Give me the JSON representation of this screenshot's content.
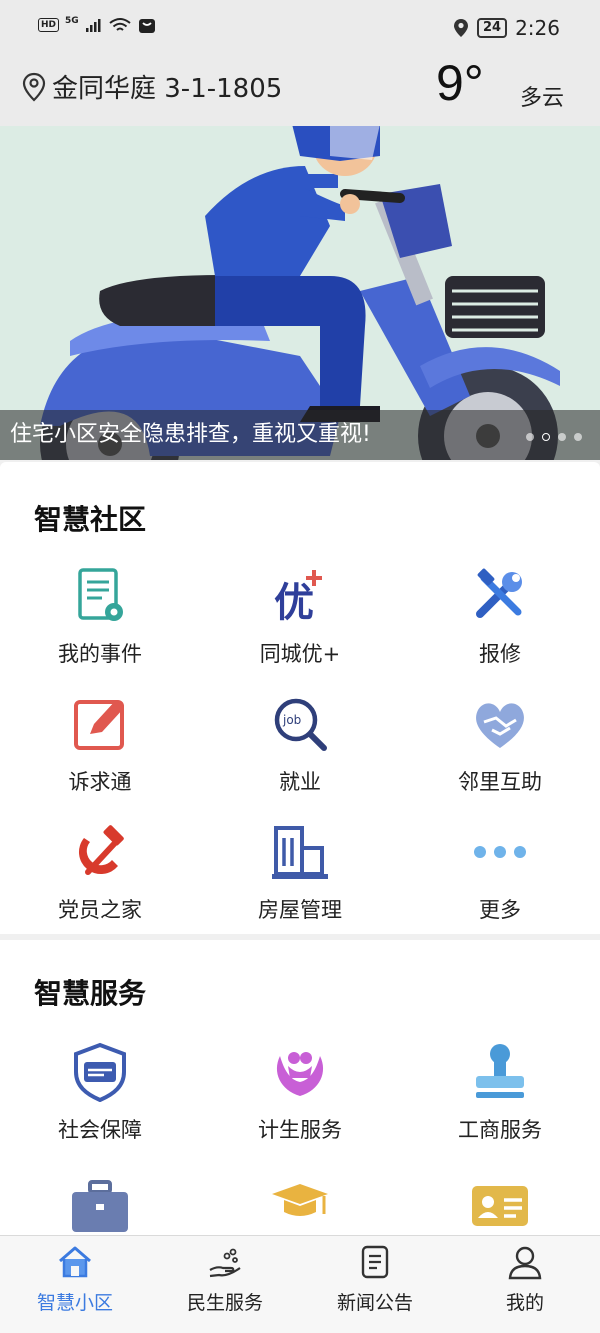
{
  "status_bar": {
    "hd": "HD",
    "network": "5G",
    "battery": "24",
    "time": "2:26"
  },
  "header": {
    "location": "金同华庭 3-1-1805",
    "temperature": "9°",
    "weather": "多云"
  },
  "banner": {
    "caption": "住宅小区安全隐患排查，重视又重视!",
    "slide_count": 4,
    "active_slide": 2
  },
  "smart_community": {
    "title": "智慧社区",
    "items": [
      {
        "label": "我的事件",
        "icon": "document-gear-icon"
      },
      {
        "label": "同城优+",
        "icon": "you-plus-icon"
      },
      {
        "label": "报修",
        "icon": "tools-icon"
      },
      {
        "label": "诉求通",
        "icon": "edit-note-icon"
      },
      {
        "label": "就业",
        "icon": "job-search-icon"
      },
      {
        "label": "邻里互助",
        "icon": "handshake-heart-icon"
      },
      {
        "label": "党员之家",
        "icon": "hammer-sickle-icon"
      },
      {
        "label": "房屋管理",
        "icon": "buildings-icon"
      },
      {
        "label": "更多",
        "icon": "more-dots-icon"
      }
    ]
  },
  "smart_service": {
    "title": "智慧服务",
    "items": [
      {
        "label": "社会保障",
        "icon": "shield-card-icon"
      },
      {
        "label": "计生服务",
        "icon": "family-care-icon"
      },
      {
        "label": "工商服务",
        "icon": "stamp-icon"
      },
      {
        "label": "",
        "icon": "briefcase-icon"
      },
      {
        "label": "",
        "icon": "graduation-cap-icon"
      },
      {
        "label": "",
        "icon": "id-card-icon"
      }
    ]
  },
  "tabbar": {
    "tabs": [
      {
        "label": "智慧小区",
        "icon": "home-icon",
        "active": true
      },
      {
        "label": "民生服务",
        "icon": "hand-service-icon",
        "active": false
      },
      {
        "label": "新闻公告",
        "icon": "news-doc-icon",
        "active": false
      },
      {
        "label": "我的",
        "icon": "user-icon",
        "active": false
      }
    ]
  },
  "colors": {
    "accent": "#3c7be0",
    "teal": "#35a59a",
    "red": "#e0584f",
    "party_red": "#d83a2c",
    "navy": "#2f3f7a"
  }
}
